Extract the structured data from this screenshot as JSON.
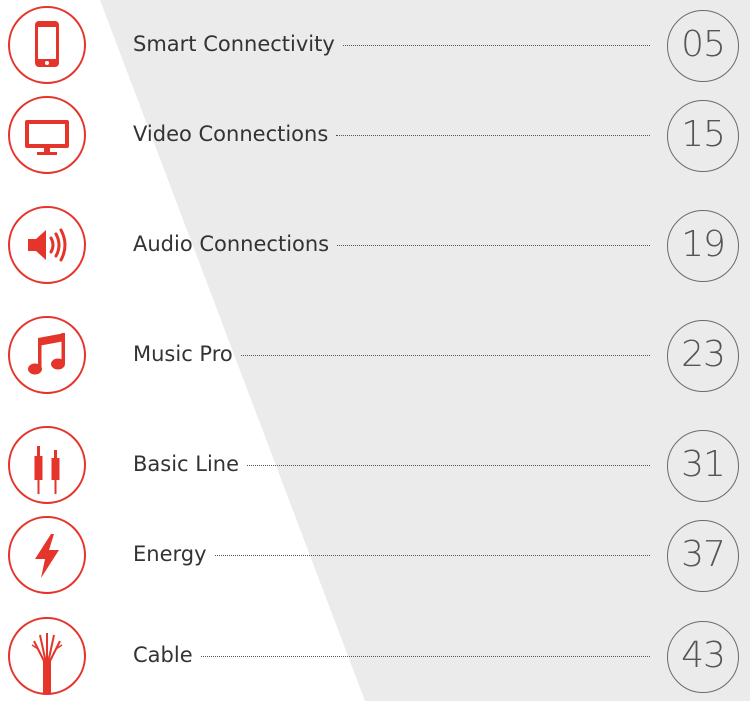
{
  "colors": {
    "accent": "#e5352b",
    "panel": "#ebebeb",
    "text": "#333333",
    "page_number": "#555555"
  },
  "items": [
    {
      "label": "Smart Connectivity",
      "page": "05",
      "icon": "smartphone-icon"
    },
    {
      "label": "Video Connections",
      "page": "15",
      "icon": "monitor-icon"
    },
    {
      "label": "Audio Connections",
      "page": "19",
      "icon": "speaker-icon"
    },
    {
      "label": "Music Pro",
      "page": "23",
      "icon": "music-note-icon"
    },
    {
      "label": "Basic Line",
      "page": "31",
      "icon": "jack-plug-icon"
    },
    {
      "label": "Energy",
      "page": "37",
      "icon": "lightning-bolt-icon"
    },
    {
      "label": "Cable",
      "page": "43",
      "icon": "cable-wires-icon"
    }
  ]
}
